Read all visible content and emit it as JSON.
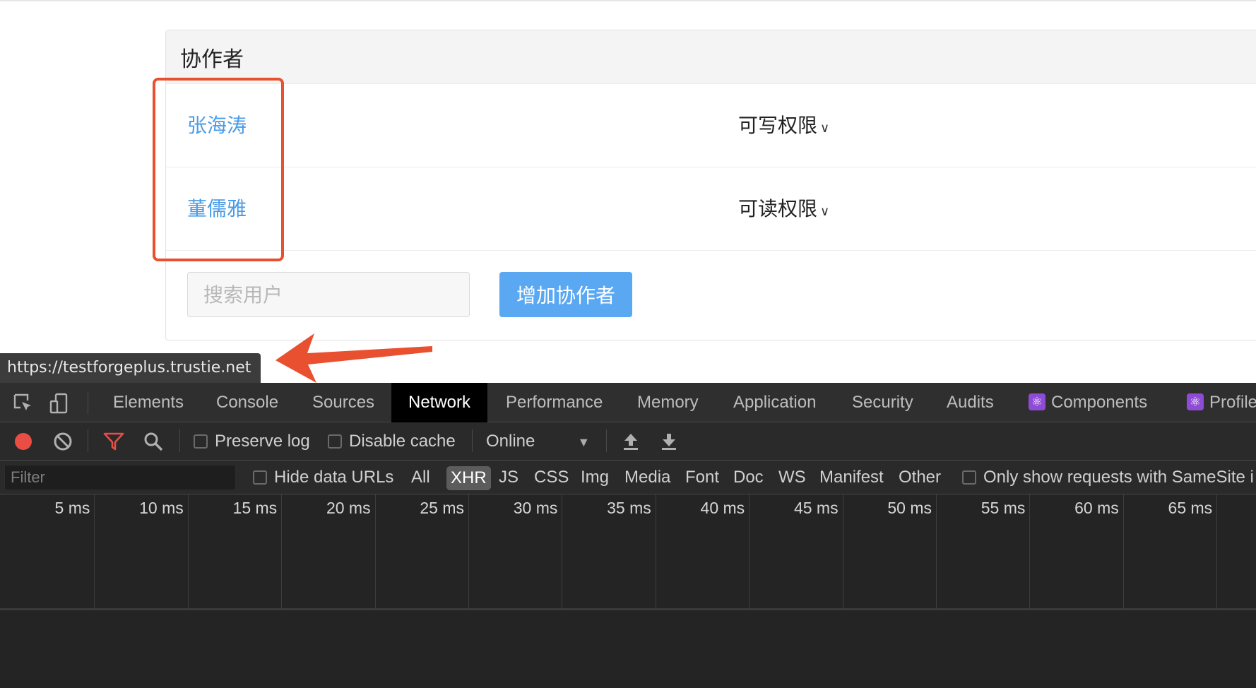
{
  "panel": {
    "title": "协作者",
    "members": [
      {
        "name": "张海涛",
        "permission": "可写权限"
      },
      {
        "name": "董儒雅",
        "permission": "可读权限"
      }
    ],
    "search_placeholder": "搜索用户",
    "add_button": "增加协作者"
  },
  "url_tooltip": "https://testforgeplus.trustie.net",
  "annotation_color": "#e8502f",
  "devtools": {
    "tabs": {
      "elements": "Elements",
      "console": "Console",
      "sources": "Sources",
      "network": "Network",
      "performance": "Performance",
      "memory": "Memory",
      "application": "Application",
      "security": "Security",
      "audits": "Audits",
      "components": "Components",
      "profiler": "Profile"
    },
    "active_tab": "Network",
    "toolbar": {
      "preserve_log": "Preserve log",
      "disable_cache": "Disable cache",
      "throttling": "Online"
    },
    "filter_placeholder": "Filter",
    "filters": {
      "hide_data_urls": "Hide data URLs",
      "all": "All",
      "xhr": "XHR",
      "js": "JS",
      "css": "CSS",
      "img": "Img",
      "media": "Media",
      "font": "Font",
      "doc": "Doc",
      "ws": "WS",
      "manifest": "Manifest",
      "other": "Other",
      "samesite": "Only show requests with SameSite i"
    },
    "active_filter": "XHR",
    "timeline_ticks": [
      "5 ms",
      "10 ms",
      "15 ms",
      "20 ms",
      "25 ms",
      "30 ms",
      "35 ms",
      "40 ms",
      "45 ms",
      "50 ms",
      "55 ms",
      "60 ms",
      "65 ms"
    ]
  }
}
